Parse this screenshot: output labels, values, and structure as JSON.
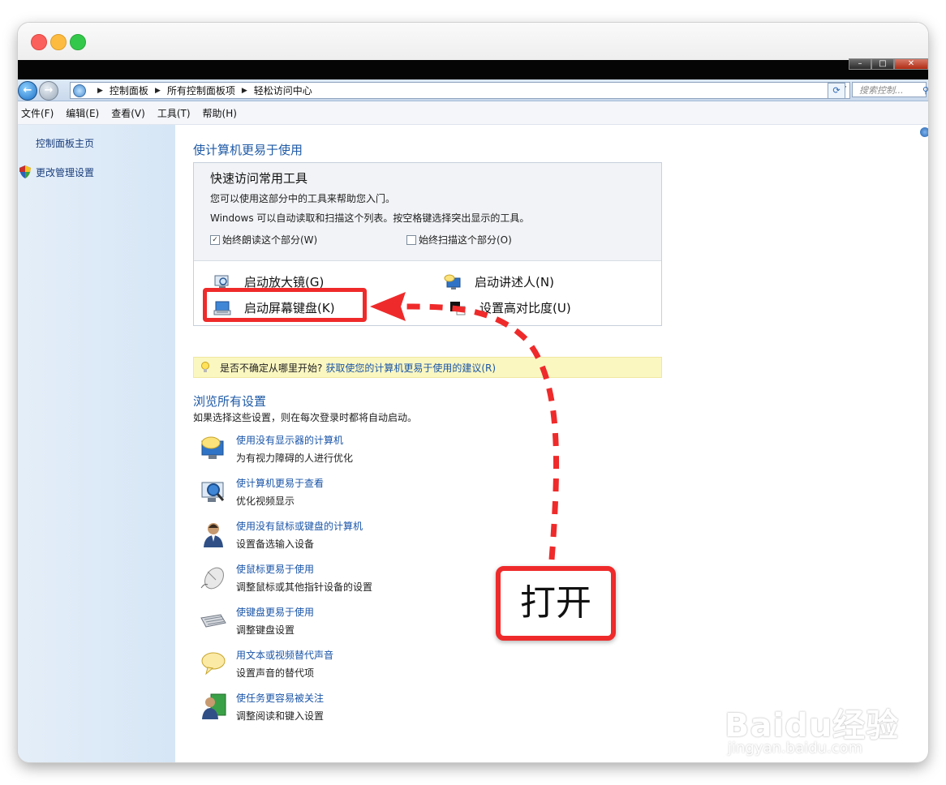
{
  "breadcrumb": [
    "控制面板",
    "所有控制面板项",
    "轻松访问中心"
  ],
  "search_placeholder": "搜索控制...",
  "menu": [
    "文件(F)",
    "编辑(E)",
    "查看(V)",
    "工具(T)",
    "帮助(H)"
  ],
  "sidebar": {
    "home": "控制面板主页",
    "admin": "更改管理设置"
  },
  "main": {
    "heading": "使计算机更易于使用",
    "quick": {
      "title": "快速访问常用工具",
      "line1": "您可以使用这部分中的工具来帮助您入门。",
      "line2": "Windows 可以自动读取和扫描这个列表。按空格键选择突出显示的工具。",
      "check_read": "始终朗读这个部分(W)",
      "check_read_checked": true,
      "check_scan": "始终扫描这个部分(O)",
      "check_scan_checked": false,
      "tools": {
        "magnifier": "启动放大镜(G)",
        "narrator": "启动讲述人(N)",
        "osk": "启动屏幕键盘(K)",
        "contrast": "设置高对比度(U)"
      }
    },
    "tip": {
      "question": "是否不确定从哪里开始?",
      "link": "获取使您的计算机更易于使用的建议(R)"
    },
    "browse": {
      "heading": "浏览所有设置",
      "sub": "如果选择这些设置，则在每次登录时都将自动启动。",
      "items": [
        {
          "icon": "monitor-speech-icon",
          "link": "使用没有显示器的计算机",
          "desc": "为有视力障碍的人进行优化"
        },
        {
          "icon": "monitor-magnifier-icon",
          "link": "使计算机更易于查看",
          "desc": "优化视频显示"
        },
        {
          "icon": "user-icon",
          "link": "使用没有鼠标或键盘的计算机",
          "desc": "设置备选输入设备"
        },
        {
          "icon": "mouse-icon",
          "link": "使鼠标更易于使用",
          "desc": "调整鼠标或其他指针设备的设置"
        },
        {
          "icon": "keyboard-icon",
          "link": "使键盘更易于使用",
          "desc": "调整键盘设置"
        },
        {
          "icon": "speech-bubble-icon",
          "link": "用文本或视频替代声音",
          "desc": "设置声音的替代项"
        },
        {
          "icon": "user-focus-icon",
          "link": "使任务更容易被关注",
          "desc": "调整阅读和键入设置"
        }
      ]
    }
  },
  "annotation": {
    "callout_text": "打开",
    "color": "#ef2a2a"
  },
  "watermark": {
    "main": "Baidu经验",
    "sub": "jingyan.baidu.com"
  }
}
